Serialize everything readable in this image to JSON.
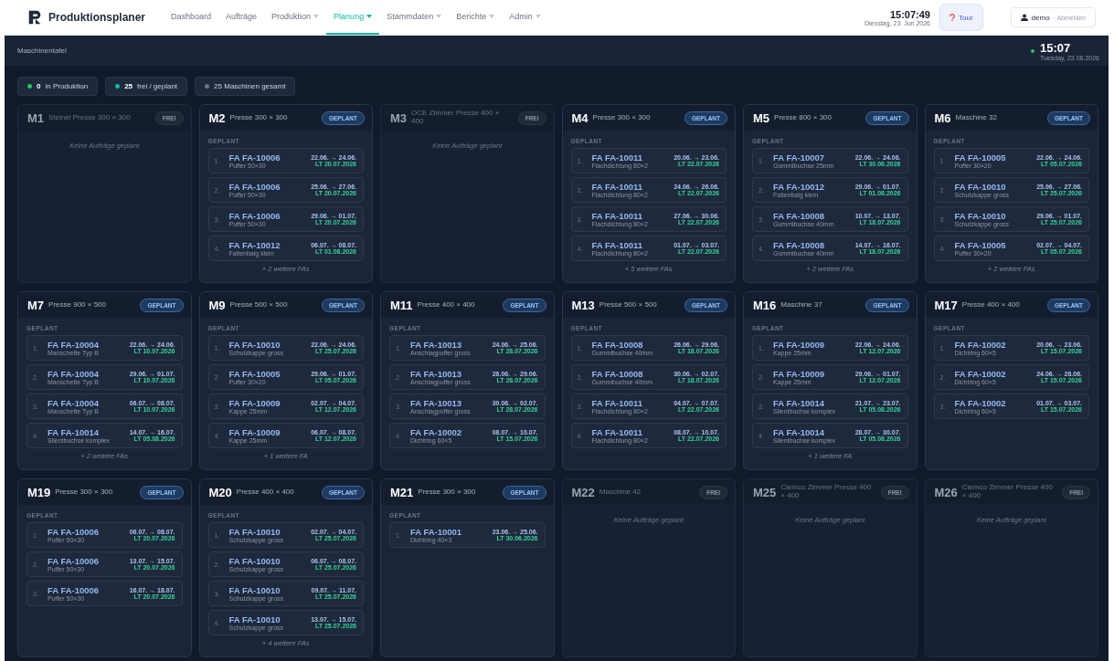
{
  "app": {
    "name": "Produktionsplaner"
  },
  "nav": [
    {
      "label": "Dashboard",
      "dropdown": false,
      "selected": false
    },
    {
      "label": "Aufträge",
      "dropdown": false,
      "selected": false
    },
    {
      "label": "Produktion",
      "dropdown": true,
      "selected": false
    },
    {
      "label": "Planung",
      "dropdown": true,
      "selected": true
    },
    {
      "label": "Stammdaten",
      "dropdown": true,
      "selected": false
    },
    {
      "label": "Berichte",
      "dropdown": true,
      "selected": false
    },
    {
      "label": "Admin",
      "dropdown": true,
      "selected": false
    }
  ],
  "header_clock": {
    "time": "15:07:49",
    "date": "Dienstag, 23. Jun 2026"
  },
  "tour_button": "Tour",
  "user": {
    "name": "demo",
    "logout": "· Abmelden"
  },
  "subheader": {
    "title": "Maschinentafel",
    "time": "15:07",
    "date": "Tuesday, 23.06.2026"
  },
  "stats": [
    {
      "value": "0",
      "label": "in Produktion",
      "color": "#22c55e"
    },
    {
      "value": "25",
      "label": "frei / geplant",
      "color": "#14b8a6"
    },
    {
      "label": "25 Maschinen gesamt",
      "color": "#6b7280"
    }
  ],
  "machines": [
    {
      "id": "M1",
      "name": "Steinel Presse 300 × 300",
      "kind": "frei",
      "badge": "FREI",
      "empty": "Keine Aufträge geplant"
    },
    {
      "id": "M2",
      "name": "Presse 300 × 300",
      "kind": "geplant",
      "badge": "GEPLANT",
      "section": "GEPLANT",
      "more": "+ 2 weitere FAs",
      "orders": [
        {
          "n": "1.",
          "fa": "FA FA-10006",
          "product": "Puffer 50×30",
          "dates": "22.06. → 24.06.",
          "lt": "LT 20.07.2026"
        },
        {
          "n": "2.",
          "fa": "FA FA-10006",
          "product": "Puffer 50×30",
          "dates": "25.06. → 27.06.",
          "lt": "LT 20.07.2026"
        },
        {
          "n": "3.",
          "fa": "FA FA-10006",
          "product": "Puffer 50×30",
          "dates": "29.06. → 01.07.",
          "lt": "LT 20.07.2026"
        },
        {
          "n": "4.",
          "fa": "FA FA-10012",
          "product": "Faltenbalg klein",
          "dates": "06.07. → 08.07.",
          "lt": "LT 01.08.2026"
        }
      ]
    },
    {
      "id": "M3",
      "name": "OCE Zimmer Presse 400 × 400",
      "kind": "frei",
      "badge": "FREI",
      "empty": "Keine Aufträge geplant"
    },
    {
      "id": "M4",
      "name": "Presse 300 × 300",
      "kind": "geplant",
      "badge": "GEPLANT",
      "section": "GEPLANT",
      "more": "+ 5 weitere FAs",
      "orders": [
        {
          "n": "1.",
          "fa": "FA FA-10011",
          "product": "Flachdichtung 80×2",
          "dates": "20.06. → 23.06.",
          "lt": "LT 22.07.2026"
        },
        {
          "n": "2.",
          "fa": "FA FA-10011",
          "product": "Flachdichtung 80×2",
          "dates": "24.06. → 26.06.",
          "lt": "LT 22.07.2026"
        },
        {
          "n": "3.",
          "fa": "FA FA-10011",
          "product": "Flachdichtung 80×2",
          "dates": "27.06. → 30.06.",
          "lt": "LT 22.07.2026"
        },
        {
          "n": "4.",
          "fa": "FA FA-10011",
          "product": "Flachdichtung 80×2",
          "dates": "01.07. → 03.07.",
          "lt": "LT 22.07.2026"
        }
      ]
    },
    {
      "id": "M5",
      "name": "Presse 800 × 300",
      "kind": "geplant",
      "badge": "GEPLANT",
      "section": "GEPLANT",
      "more": "+ 2 weitere FAs",
      "orders": [
        {
          "n": "1.",
          "fa": "FA FA-10007",
          "product": "Gummibuchse 25mm",
          "dates": "22.06. → 24.06.",
          "lt": "LT 30.06.2026"
        },
        {
          "n": "2.",
          "fa": "FA FA-10012",
          "product": "Faltenbalg klein",
          "dates": "29.06. → 01.07.",
          "lt": "LT 01.08.2026"
        },
        {
          "n": "3.",
          "fa": "FA FA-10008",
          "product": "Gummibuchse 40mm",
          "dates": "10.07. → 13.07.",
          "lt": "LT 18.07.2026"
        },
        {
          "n": "4.",
          "fa": "FA FA-10008",
          "product": "Gummibuchse 40mm",
          "dates": "14.07. → 16.07.",
          "lt": "LT 18.07.2026"
        }
      ]
    },
    {
      "id": "M6",
      "name": "Maschine 32",
      "kind": "geplant",
      "badge": "GEPLANT",
      "section": "GEPLANT",
      "more": "+ 2 weitere FAs",
      "orders": [
        {
          "n": "1.",
          "fa": "FA FA-10005",
          "product": "Puffer 30×20",
          "dates": "22.06. → 24.06.",
          "lt": "LT 05.07.2026"
        },
        {
          "n": "2.",
          "fa": "FA FA-10010",
          "product": "Schutzkappe gross",
          "dates": "25.06. → 27.06.",
          "lt": "LT 25.07.2026"
        },
        {
          "n": "3.",
          "fa": "FA FA-10010",
          "product": "Schutzkappe gross",
          "dates": "29.06. → 01.07.",
          "lt": "LT 25.07.2026"
        },
        {
          "n": "4.",
          "fa": "FA FA-10005",
          "product": "Puffer 30×20",
          "dates": "02.07. → 04.07.",
          "lt": "LT 05.07.2026"
        }
      ]
    },
    {
      "id": "M7",
      "name": "Presse 900 × 500",
      "kind": "geplant",
      "badge": "GEPLANT",
      "section": "GEPLANT",
      "more": "+ 2 weitere FAs",
      "orders": [
        {
          "n": "1.",
          "fa": "FA FA-10004",
          "product": "Manschette Typ B",
          "dates": "22.06. → 24.06.",
          "lt": "LT 10.07.2026"
        },
        {
          "n": "2.",
          "fa": "FA FA-10004",
          "product": "Manschette Typ B",
          "dates": "29.06. → 01.07.",
          "lt": "LT 10.07.2026"
        },
        {
          "n": "3.",
          "fa": "FA FA-10004",
          "product": "Manschette Typ B",
          "dates": "06.07. → 08.07.",
          "lt": "LT 10.07.2026"
        },
        {
          "n": "4.",
          "fa": "FA FA-10014",
          "product": "Silentbuchse komplex",
          "dates": "14.07. → 16.07.",
          "lt": "LT 05.08.2026"
        }
      ]
    },
    {
      "id": "M9",
      "name": "Presse 500 × 500",
      "kind": "geplant",
      "badge": "GEPLANT",
      "section": "GEPLANT",
      "more": "+ 1 weitere FA",
      "orders": [
        {
          "n": "1.",
          "fa": "FA FA-10010",
          "product": "Schutzkappe gross",
          "dates": "22.06. → 24.06.",
          "lt": "LT 25.07.2026"
        },
        {
          "n": "2.",
          "fa": "FA FA-10005",
          "product": "Puffer 30×20",
          "dates": "29.06. → 01.07.",
          "lt": "LT 05.07.2026"
        },
        {
          "n": "3.",
          "fa": "FA FA-10009",
          "product": "Kappe 25mm",
          "dates": "02.07. → 04.07.",
          "lt": "LT 12.07.2026"
        },
        {
          "n": "4.",
          "fa": "FA FA-10009",
          "product": "Kappe 25mm",
          "dates": "06.07. → 08.07.",
          "lt": "LT 12.07.2026"
        }
      ]
    },
    {
      "id": "M11",
      "name": "Presse 400 × 400",
      "kind": "geplant",
      "badge": "GEPLANT",
      "section": "GEPLANT",
      "orders": [
        {
          "n": "1.",
          "fa": "FA FA-10013",
          "product": "Anschlagpuffer gross",
          "dates": "24.06. → 25.06.",
          "lt": "LT 28.07.2026"
        },
        {
          "n": "2.",
          "fa": "FA FA-10013",
          "product": "Anschlagpuffer gross",
          "dates": "26.06. → 29.06.",
          "lt": "LT 28.07.2026"
        },
        {
          "n": "3.",
          "fa": "FA FA-10013",
          "product": "Anschlagpuffer gross",
          "dates": "30.06. → 02.07.",
          "lt": "LT 28.07.2026"
        },
        {
          "n": "4.",
          "fa": "FA FA-10002",
          "product": "Dichtring 60×5",
          "dates": "08.07. → 10.07.",
          "lt": "LT 15.07.2026"
        }
      ]
    },
    {
      "id": "M13",
      "name": "Presse 500 × 500",
      "kind": "geplant",
      "badge": "GEPLANT",
      "section": "GEPLANT",
      "orders": [
        {
          "n": "1.",
          "fa": "FA FA-10008",
          "product": "Gummibuchse 40mm",
          "dates": "26.06. → 29.06.",
          "lt": "LT 18.07.2026"
        },
        {
          "n": "2.",
          "fa": "FA FA-10008",
          "product": "Gummibuchse 40mm",
          "dates": "30.06. → 02.07.",
          "lt": "LT 18.07.2026"
        },
        {
          "n": "3.",
          "fa": "FA FA-10011",
          "product": "Flachdichtung 80×2",
          "dates": "04.07. → 07.07.",
          "lt": "LT 22.07.2026"
        },
        {
          "n": "4.",
          "fa": "FA FA-10011",
          "product": "Flachdichtung 80×2",
          "dates": "08.07. → 10.07.",
          "lt": "LT 22.07.2026"
        }
      ]
    },
    {
      "id": "M16",
      "name": "Maschine 37",
      "kind": "geplant",
      "badge": "GEPLANT",
      "section": "GEPLANT",
      "more": "+ 1 weitere FA",
      "orders": [
        {
          "n": "1.",
          "fa": "FA FA-10009",
          "product": "Kappe 25mm",
          "dates": "22.06. → 24.06.",
          "lt": "LT 12.07.2026"
        },
        {
          "n": "2.",
          "fa": "FA FA-10009",
          "product": "Kappe 25mm",
          "dates": "29.06. → 01.07.",
          "lt": "LT 12.07.2026"
        },
        {
          "n": "3.",
          "fa": "FA FA-10014",
          "product": "Silentbuchse komplex",
          "dates": "21.07. → 23.07.",
          "lt": "LT 05.08.2026"
        },
        {
          "n": "4.",
          "fa": "FA FA-10014",
          "product": "Silentbuchse komplex",
          "dates": "28.07. → 30.07.",
          "lt": "LT 05.08.2026"
        }
      ]
    },
    {
      "id": "M17",
      "name": "Presse 400 × 400",
      "kind": "geplant",
      "badge": "GEPLANT",
      "section": "GEPLANT",
      "orders": [
        {
          "n": "1.",
          "fa": "FA FA-10002",
          "product": "Dichtring 60×5",
          "dates": "20.06. → 23.06.",
          "lt": "LT 15.07.2026"
        },
        {
          "n": "2.",
          "fa": "FA FA-10002",
          "product": "Dichtring 60×5",
          "dates": "24.06. → 26.06.",
          "lt": "LT 15.07.2026"
        },
        {
          "n": "3.",
          "fa": "FA FA-10002",
          "product": "Dichtring 60×5",
          "dates": "01.07. → 03.07.",
          "lt": "LT 15.07.2026"
        }
      ]
    },
    {
      "id": "M19",
      "name": "Presse 300 × 300",
      "kind": "geplant",
      "badge": "GEPLANT",
      "section": "GEPLANT",
      "orders": [
        {
          "n": "1.",
          "fa": "FA FA-10006",
          "product": "Puffer 50×30",
          "dates": "06.07. → 08.07.",
          "lt": "LT 20.07.2026"
        },
        {
          "n": "2.",
          "fa": "FA FA-10006",
          "product": "Puffer 50×30",
          "dates": "13.07. → 15.07.",
          "lt": "LT 20.07.2026"
        },
        {
          "n": "3.",
          "fa": "FA FA-10006",
          "product": "Puffer 50×30",
          "dates": "16.07. → 18.07.",
          "lt": "LT 20.07.2026"
        }
      ]
    },
    {
      "id": "M20",
      "name": "Presse 400 × 400",
      "kind": "geplant",
      "badge": "GEPLANT",
      "section": "GEPLANT",
      "more": "+ 4 weitere FAs",
      "orders": [
        {
          "n": "1.",
          "fa": "FA FA-10010",
          "product": "Schutzkappe gross",
          "dates": "02.07. → 04.07.",
          "lt": "LT 25.07.2026"
        },
        {
          "n": "2.",
          "fa": "FA FA-10010",
          "product": "Schutzkappe gross",
          "dates": "06.07. → 08.07.",
          "lt": "LT 25.07.2026"
        },
        {
          "n": "3.",
          "fa": "FA FA-10010",
          "product": "Schutzkappe gross",
          "dates": "09.07. → 11.07.",
          "lt": "LT 25.07.2026"
        },
        {
          "n": "4.",
          "fa": "FA FA-10010",
          "product": "Schutzkappe gross",
          "dates": "13.07. → 15.07.",
          "lt": "LT 25.07.2026"
        }
      ]
    },
    {
      "id": "M21",
      "name": "Presse 300 × 300",
      "kind": "geplant",
      "badge": "GEPLANT",
      "section": "GEPLANT",
      "orders": [
        {
          "n": "1.",
          "fa": "FA FA-10001",
          "product": "Dichtring 40×3",
          "dates": "23.06. → 25.06.",
          "lt": "LT 30.06.2026"
        }
      ]
    },
    {
      "id": "M22",
      "name": "Maschine 42",
      "kind": "frei",
      "badge": "FREI",
      "empty": "Keine Aufträge geplant"
    },
    {
      "id": "M25",
      "name": "Clemco Zimmer Presse 400 × 400",
      "kind": "frei",
      "badge": "FREI",
      "empty": "Keine Aufträge geplant"
    },
    {
      "id": "M26",
      "name": "Clemco Zimmer Presse 400 × 400",
      "kind": "frei",
      "badge": "FREI",
      "empty": "Keine Aufträge geplant"
    }
  ]
}
